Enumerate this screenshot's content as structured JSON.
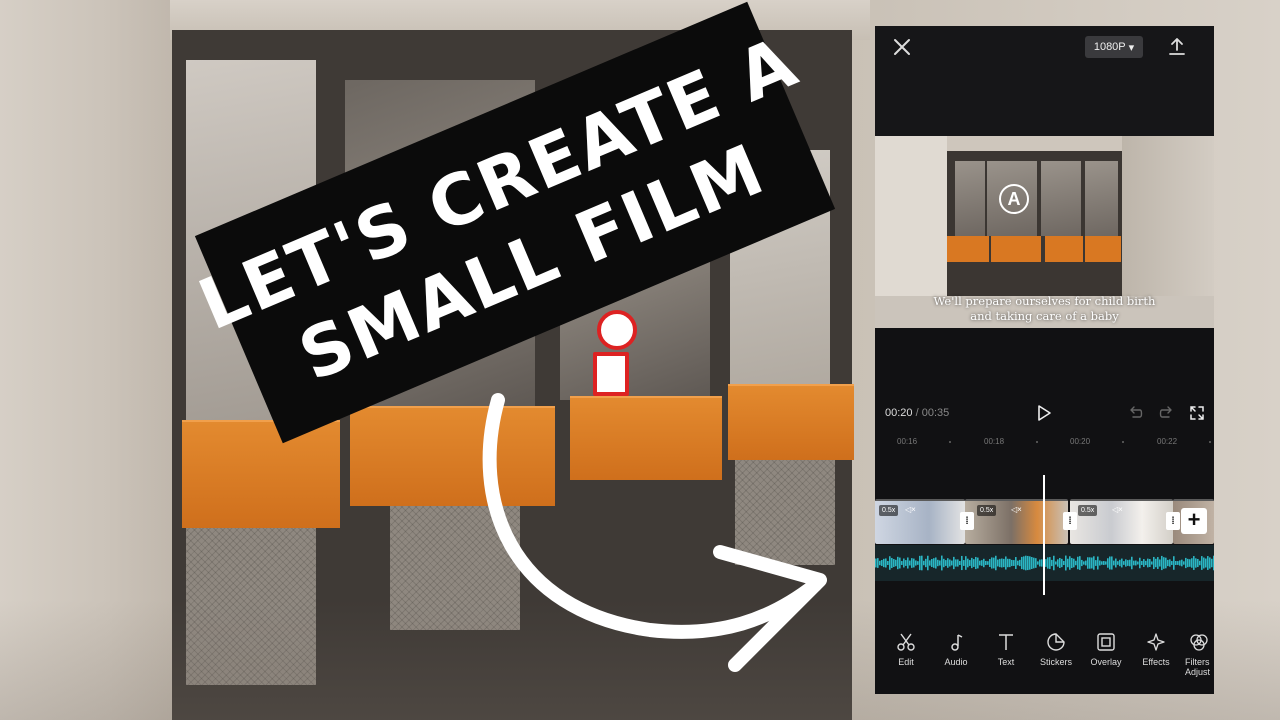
{
  "thumbnail": {
    "title_lines": [
      "LET'S CREATE A",
      "SMALL FILM"
    ]
  },
  "editor": {
    "top_bar": {
      "resolution_label": "1080P",
      "close_icon": "close-icon",
      "export_icon": "export-icon"
    },
    "preview": {
      "logo_text": "A",
      "subtitle_lines": [
        "We'll prepare ourselves for child birth",
        "and taking care of a baby"
      ]
    },
    "playback": {
      "current_time": "00:20",
      "separator": "/",
      "total_time": "00:35"
    },
    "ruler_labels": [
      "00:16",
      "00:18",
      "00:20",
      "00:22"
    ],
    "clips": [
      {
        "speed": "0.5x"
      },
      {
        "speed": "0.5x"
      },
      {
        "speed": "0.5x"
      },
      {
        "speed": ""
      }
    ],
    "toolbar": {
      "items": [
        {
          "label": "Edit",
          "icon": "scissors-icon"
        },
        {
          "label": "Audio",
          "icon": "music-note-icon"
        },
        {
          "label": "Text",
          "icon": "text-icon"
        },
        {
          "label": "Stickers",
          "icon": "sticker-icon"
        },
        {
          "label": "Overlay",
          "icon": "overlay-icon"
        },
        {
          "label": "Effects",
          "icon": "sparkle-icon"
        },
        {
          "label": "Filters",
          "label2": "Adjust",
          "icon": "filter-icon"
        }
      ]
    },
    "colors": {
      "waveform": "#2bb6c4",
      "panel": "#111113"
    }
  }
}
